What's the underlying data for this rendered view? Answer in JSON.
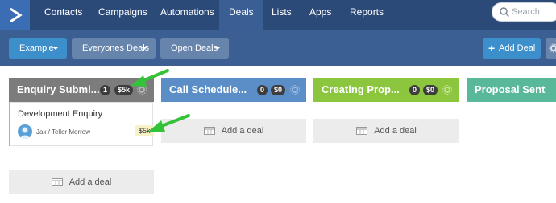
{
  "nav": {
    "items": [
      "Contacts",
      "Campaigns",
      "Automations",
      "Deals",
      "Lists",
      "Apps",
      "Reports"
    ],
    "active": "Deals",
    "search_placeholder": "Search"
  },
  "toolbar": {
    "pipeline_label": "Example",
    "owner_label": "Everyones Deals",
    "status_label": "Open Deals",
    "add_deal_label": "Add Deal"
  },
  "columns": [
    {
      "title": "Enquiry Submi...",
      "count": "1",
      "value": "$5k",
      "color": "#7c7c7c"
    },
    {
      "title": "Call Schedule...",
      "count": "0",
      "value": "$0",
      "color": "#5b8ec7"
    },
    {
      "title": "Creating Prop...",
      "count": "0",
      "value": "$0",
      "color": "#8cc63f"
    },
    {
      "title": "Proposal Sent",
      "count": "",
      "value": "",
      "color": "#5ab89a"
    }
  ],
  "deal": {
    "title": "Development Enquiry",
    "contact": "Jax / Teller Morrow",
    "value": "$5k",
    "accent": "#f0a832"
  },
  "add_deal_text": "Add a deal",
  "colors": {
    "nav_bg": "#2c4a78",
    "toolbar_bg": "#3c5f93",
    "primary_button": "#3d8fcb",
    "arrow": "#34c238"
  }
}
